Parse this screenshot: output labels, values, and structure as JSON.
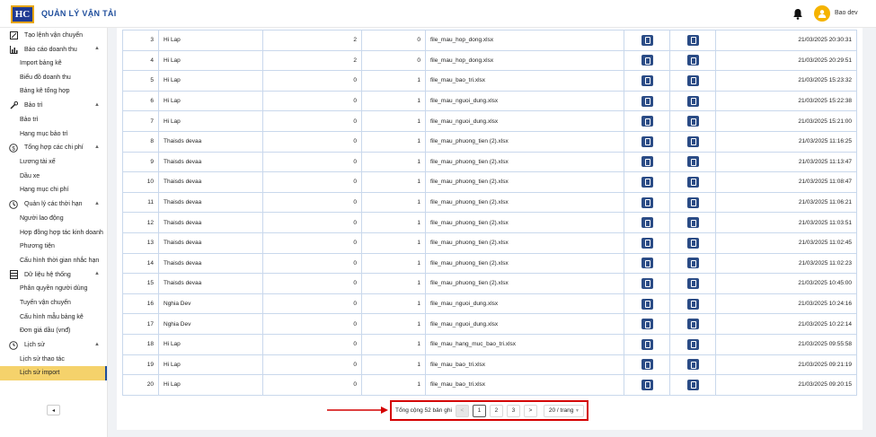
{
  "header": {
    "logo_text": "HC",
    "title": "QUẢN LÝ VẬN TẢI",
    "user_name": "Bao dev"
  },
  "sidebar": {
    "items": [
      {
        "type": "group",
        "label": "Tạo lệnh vận chuyển",
        "icon": "create-order-icon",
        "chevron": ""
      },
      {
        "type": "group",
        "label": "Báo cáo doanh thu",
        "icon": "bar-chart-icon",
        "chevron": "▲"
      },
      {
        "type": "sub",
        "label": "Import bảng kê"
      },
      {
        "type": "sub",
        "label": "Biểu đồ doanh thu"
      },
      {
        "type": "sub",
        "label": "Bảng kê tổng hợp"
      },
      {
        "type": "group",
        "label": "Bảo trì",
        "icon": "wrench-icon",
        "chevron": "▲"
      },
      {
        "type": "sub",
        "label": "Bảo trì"
      },
      {
        "type": "sub",
        "label": "Hạng mục bảo trì"
      },
      {
        "type": "group",
        "label": "Tổng hợp các chi phí",
        "icon": "dollar-icon",
        "chevron": "▲"
      },
      {
        "type": "sub",
        "label": "Lương tài xế"
      },
      {
        "type": "sub",
        "label": "Dầu xe"
      },
      {
        "type": "sub",
        "label": "Hạng mục chi phí"
      },
      {
        "type": "group",
        "label": "Quản lý các thời hạn",
        "icon": "clock-icon",
        "chevron": "▲"
      },
      {
        "type": "sub",
        "label": "Người lao động"
      },
      {
        "type": "sub",
        "label": "Hợp đồng hợp tác kinh doanh"
      },
      {
        "type": "sub",
        "label": "Phương tiện"
      },
      {
        "type": "sub",
        "label": "Cấu hình thời gian nhắc hạn"
      },
      {
        "type": "group",
        "label": "Dữ liệu hệ thống",
        "icon": "database-icon",
        "chevron": "▲"
      },
      {
        "type": "sub",
        "label": "Phân quyền người dùng"
      },
      {
        "type": "sub",
        "label": "Tuyến vận chuyển"
      },
      {
        "type": "sub",
        "label": "Cấu hình mẫu bảng kê"
      },
      {
        "type": "sub",
        "label": "Đơn giá dầu (vnđ)"
      },
      {
        "type": "group",
        "label": "Lịch sử",
        "icon": "history-icon",
        "chevron": "▲"
      },
      {
        "type": "sub",
        "label": "Lịch sử thao tác"
      },
      {
        "type": "sub",
        "label": "Lịch sử import",
        "active": true
      }
    ],
    "collapse_label": "◂"
  },
  "table": {
    "rows": [
      {
        "no": "3",
        "user": "Hi Lap",
        "a": "2",
        "b": "0",
        "file": "file_mau_hop_dong.xlsx",
        "date": "21/03/2025 20:30:31"
      },
      {
        "no": "4",
        "user": "Hi Lap",
        "a": "2",
        "b": "0",
        "file": "file_mau_hop_dong.xlsx",
        "date": "21/03/2025 20:29:51"
      },
      {
        "no": "5",
        "user": "Hi Lap",
        "a": "0",
        "b": "1",
        "file": "file_mau_bao_tri.xlsx",
        "date": "21/03/2025 15:23:32"
      },
      {
        "no": "6",
        "user": "Hi Lap",
        "a": "0",
        "b": "1",
        "file": "file_mau_nguoi_dung.xlsx",
        "date": "21/03/2025 15:22:38"
      },
      {
        "no": "7",
        "user": "Hi Lap",
        "a": "0",
        "b": "1",
        "file": "file_mau_nguoi_dung.xlsx",
        "date": "21/03/2025 15:21:00"
      },
      {
        "no": "8",
        "user": "Thaisds devaa",
        "a": "0",
        "b": "1",
        "file": "file_mau_phuong_tien (2).xlsx",
        "date": "21/03/2025 11:16:25"
      },
      {
        "no": "9",
        "user": "Thaisds devaa",
        "a": "0",
        "b": "1",
        "file": "file_mau_phuong_tien (2).xlsx",
        "date": "21/03/2025 11:13:47"
      },
      {
        "no": "10",
        "user": "Thaisds devaa",
        "a": "0",
        "b": "1",
        "file": "file_mau_phuong_tien (2).xlsx",
        "date": "21/03/2025 11:08:47"
      },
      {
        "no": "11",
        "user": "Thaisds devaa",
        "a": "0",
        "b": "1",
        "file": "file_mau_phuong_tien (2).xlsx",
        "date": "21/03/2025 11:06:21"
      },
      {
        "no": "12",
        "user": "Thaisds devaa",
        "a": "0",
        "b": "1",
        "file": "file_mau_phuong_tien (2).xlsx",
        "date": "21/03/2025 11:03:51"
      },
      {
        "no": "13",
        "user": "Thaisds devaa",
        "a": "0",
        "b": "1",
        "file": "file_mau_phuong_tien (2).xlsx",
        "date": "21/03/2025 11:02:45"
      },
      {
        "no": "14",
        "user": "Thaisds devaa",
        "a": "0",
        "b": "1",
        "file": "file_mau_phuong_tien (2).xlsx",
        "date": "21/03/2025 11:02:23"
      },
      {
        "no": "15",
        "user": "Thaisds devaa",
        "a": "0",
        "b": "1",
        "file": "file_mau_phuong_tien (2).xlsx",
        "date": "21/03/2025 10:45:00"
      },
      {
        "no": "16",
        "user": "Nghia Dev",
        "a": "0",
        "b": "1",
        "file": "file_mau_nguoi_dung.xlsx",
        "date": "21/03/2025 10:24:16"
      },
      {
        "no": "17",
        "user": "Nghia Dev",
        "a": "0",
        "b": "1",
        "file": "file_mau_nguoi_dung.xlsx",
        "date": "21/03/2025 10:22:14"
      },
      {
        "no": "18",
        "user": "Hi Lap",
        "a": "0",
        "b": "1",
        "file": "file_mau_hang_muc_bao_tri.xlsx",
        "date": "21/03/2025 09:55:58"
      },
      {
        "no": "19",
        "user": "Hi Lap",
        "a": "0",
        "b": "1",
        "file": "file_mau_bao_tri.xlsx",
        "date": "21/03/2025 09:21:19"
      },
      {
        "no": "20",
        "user": "Hi Lap",
        "a": "0",
        "b": "1",
        "file": "file_mau_bao_tri.xlsx",
        "date": "21/03/2025 09:20:15"
      }
    ]
  },
  "pagination": {
    "total_label": "Tổng cộng 52 bản ghi",
    "prev": "<",
    "pages": [
      "1",
      "2",
      "3"
    ],
    "current": "1",
    "next": ">",
    "page_size": "20 / trang"
  },
  "colors": {
    "highlight": "#d40000",
    "active_item": "#f5d26b",
    "file_button": "#2b4c86"
  }
}
